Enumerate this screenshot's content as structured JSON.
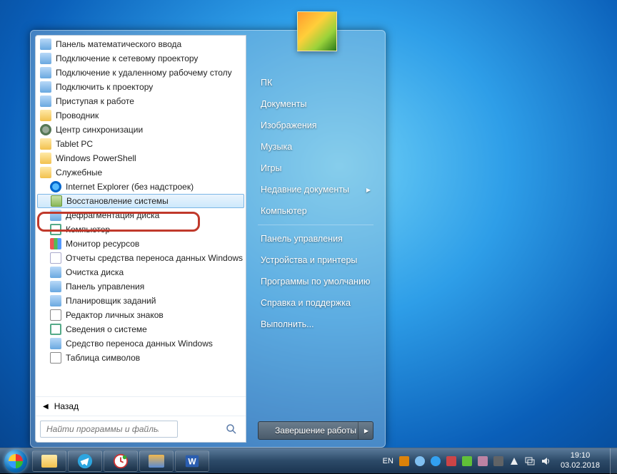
{
  "programs": [
    {
      "label": "Панель математического ввода",
      "cls": "ic-app"
    },
    {
      "label": "Подключение к сетевому проектору",
      "cls": "ic-app"
    },
    {
      "label": "Подключение к удаленному рабочему столу",
      "cls": "ic-app"
    },
    {
      "label": "Подключить к проектору",
      "cls": "ic-app"
    },
    {
      "label": "Приступая к работе",
      "cls": "ic-app"
    },
    {
      "label": "Проводник",
      "cls": "ic-folder"
    },
    {
      "label": "Центр синхронизации",
      "cls": "ic-gear"
    },
    {
      "label": "Tablet PC",
      "cls": "ic-folder"
    },
    {
      "label": "Windows PowerShell",
      "cls": "ic-folder"
    },
    {
      "label": "Служебные",
      "cls": "ic-folder"
    },
    {
      "label": "Internet Explorer (без надстроек)",
      "cls": "ic-ie",
      "indent": true
    },
    {
      "label": "Восстановление системы",
      "cls": "ic-rstr",
      "indent": true,
      "hl": true
    },
    {
      "label": "Дефрагментация диска",
      "cls": "ic-app",
      "indent": true
    },
    {
      "label": "Компьютер",
      "cls": "ic-mon",
      "indent": true
    },
    {
      "label": "Монитор ресурсов",
      "cls": "ic-chart",
      "indent": true
    },
    {
      "label": "Отчеты средства переноса данных Windows",
      "cls": "ic-doc",
      "indent": true
    },
    {
      "label": "Очистка диска",
      "cls": "ic-app",
      "indent": true
    },
    {
      "label": "Панель управления",
      "cls": "ic-app",
      "indent": true
    },
    {
      "label": "Планировщик заданий",
      "cls": "ic-app",
      "indent": true
    },
    {
      "label": "Редактор личных знаков",
      "cls": "ic-char",
      "indent": true
    },
    {
      "label": "Сведения о системе",
      "cls": "ic-mon",
      "indent": true
    },
    {
      "label": "Средство переноса данных Windows",
      "cls": "ic-app",
      "indent": true
    },
    {
      "label": "Таблица символов",
      "cls": "ic-char",
      "indent": true
    }
  ],
  "back_label": "Назад",
  "search_placeholder": "Найти программы и файлы",
  "right_items_a": [
    "ПК",
    "Документы",
    "Изображения",
    "Музыка",
    "Игры",
    "Недавние документы",
    "Компьютер"
  ],
  "right_items_b": [
    "Панель управления",
    "Устройства и принтеры",
    "Программы по умолчанию",
    "Справка и поддержка",
    "Выполнить..."
  ],
  "recent_has_arrow_index": 5,
  "shutdown_label": "Завершение работы",
  "tray_lang": "EN",
  "clock_time": "19:10",
  "clock_date": "03.02.2018"
}
